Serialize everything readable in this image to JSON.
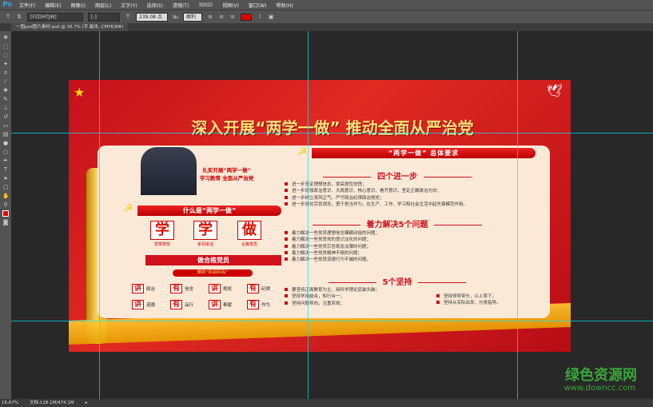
{
  "app": {
    "logo": "Ps",
    "menus": [
      "文件(F)",
      "编辑(E)",
      "图像(I)",
      "图层(L)",
      "文字(Y)",
      "选择(S)",
      "滤镜(T)",
      "3D(D)",
      "视图(V)",
      "窗口(W)",
      "帮助(H)"
    ]
  },
  "options": {
    "font_family": "[FZDHTJW]",
    "font_style": "[-]",
    "font_size": "239.08 点",
    "aa": "aₐ",
    "aa_mode": "犀利",
    "text_color": "#e00000"
  },
  "document_tab": "一图psd图片素材.psd @ 16.7% (字 副本, CMYK/8#)",
  "status": {
    "zoom": "16.67%",
    "doc": "文档:118.1M/474.1M"
  },
  "poster": {
    "title": "深入开展“两学一做” 推动全面从严治党",
    "slogan1": "扎实开展“两学一做”",
    "slogan2": "学习教育  全面从严治党",
    "what_is": "什么是“两学一做”",
    "big": [
      {
        "char": "学",
        "cap": "党章党规"
      },
      {
        "char": "学",
        "cap": "系列讲话"
      },
      {
        "char": "做",
        "cap": "合格党员"
      }
    ],
    "qualified": "做合格党员",
    "four": "做到“四讲四有”",
    "jy": [
      {
        "k": "讲",
        "v": "政治"
      },
      {
        "k": "有",
        "v": "信念"
      },
      {
        "k": "讲",
        "v": "规矩"
      },
      {
        "k": "有",
        "v": "纪律"
      },
      {
        "k": "讲",
        "v": "道德"
      },
      {
        "k": "有",
        "v": "品行"
      },
      {
        "k": "讲",
        "v": "奉献"
      },
      {
        "k": "有",
        "v": "作为"
      }
    ],
    "req": "“两学一做” 总体要求",
    "s1": "四个进一步",
    "s1_items": [
      "进一步坚定理想信念，提高党性觉悟；",
      "进一步增强政治意识、大局意识、核心意识、看齐意识，坚定正确政治方向；",
      "进一步树立清风正气，严守政治纪律政治规矩；",
      "进一步强化宗旨观念，勇于担当作为，在生产、工作、学习和社会生活中起先锋模范作用。"
    ],
    "s2": "着力解决5个问题",
    "s2_items": [
      "着力解决一些党员理想信念模糊动摇的问题；",
      "着力解决一些党员党的意识淡化的问题；",
      "着力解决一些党员宗旨观念淡薄的问题；",
      "着力解决一些党员精神不振的问题；",
      "着力解决一些党员道德行为不端的问题。"
    ],
    "s3": "5个坚持",
    "s3_items": [
      "要坚持正面教育为主，用科学理论武装头脑；",
      "坚持学用结合，知行合一；",
      "坚持问题导向，注重实效；"
    ],
    "s3_right": [
      "坚持领导带头，以上率下；",
      "坚持从实际出发，分类指导。"
    ]
  },
  "watermark": {
    "cn": "绿色资源网",
    "url": "www.downcc.com"
  }
}
